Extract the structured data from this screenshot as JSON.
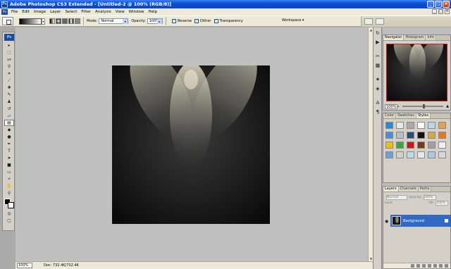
{
  "app": {
    "title": "Adobe Photoshop CS3 Extended - [Untitled-2 @ 100% (RGB/8)]",
    "icon": "Ps"
  },
  "window_buttons": {
    "minimize": "_",
    "maximize": "□",
    "close": "×"
  },
  "menu": [
    "File",
    "Edit",
    "Image",
    "Layer",
    "Select",
    "Filter",
    "Analysis",
    "View",
    "Window",
    "Help"
  ],
  "options": {
    "mode_label": "Mode:",
    "mode_value": "Normal",
    "opacity_label": "Opacity:",
    "opacity_value": "100%",
    "reverse_label": "Reverse",
    "dither_label": "Dither",
    "transparency_label": "Transparency",
    "workspace_label": "Workspace ▾",
    "checked": [
      "Reverse",
      "Dither",
      "Transparency"
    ]
  },
  "status": {
    "zoom": "100%",
    "doc": "Doc: 732.4K/732.4K"
  },
  "navigator_panel": {
    "tabs": [
      "Navigator",
      "Histogram",
      "Info"
    ],
    "zoom": "100%"
  },
  "color_panel": {
    "tabs": [
      "Color",
      "Swatches",
      "Styles"
    ],
    "swatch_colors": [
      "#1c8fd8",
      "#e9e9e9",
      "#aaaaaa",
      "#ffffff",
      "#b8d7e8",
      "#e8a04c",
      "#4a8ed8",
      "#b8c0c8",
      "#2a4a7a",
      "#111111",
      "#d8a848",
      "#e87820",
      "#e8c010",
      "#38a838",
      "#c81818",
      "#7a3a1a",
      "#a0a0a0",
      "#f0f0f0",
      "#6aa0d8",
      "#d0d0d0",
      "#c0d8f0",
      "#e0e8f0",
      "#a8c8e8",
      "#d8d8d8"
    ]
  },
  "layers_panel": {
    "tabs": [
      "Layers",
      "Channels",
      "Paths"
    ],
    "blend_mode": "Normal",
    "opacity_label": "Opacity:",
    "opacity_value": "100%",
    "lock_label": "Lock:",
    "fill_label": "Fill:",
    "fill_value": "100%",
    "layer_name": "Background"
  },
  "colors": {
    "title_bar": "#0a4fd4",
    "ui_gray": "#ece9d8",
    "selection": "#316ac5",
    "canvas_bg": "#111111",
    "workspace_bg": "#c0c0c0",
    "spot_light": "#e8e4cc"
  },
  "tools": [
    "move-tool",
    "marquee-tool",
    "lasso-tool",
    "magic-wand-tool",
    "crop-tool",
    "slice-tool",
    "healing-brush-tool",
    "brush-tool",
    "clone-stamp-tool",
    "history-brush-tool",
    "eraser-tool",
    "gradient-tool",
    "blur-tool",
    "dodge-tool",
    "pen-tool",
    "type-tool",
    "path-selection-tool",
    "shape-tool",
    "notes-tool",
    "eyedropper-tool",
    "hand-tool",
    "zoom-tool"
  ]
}
